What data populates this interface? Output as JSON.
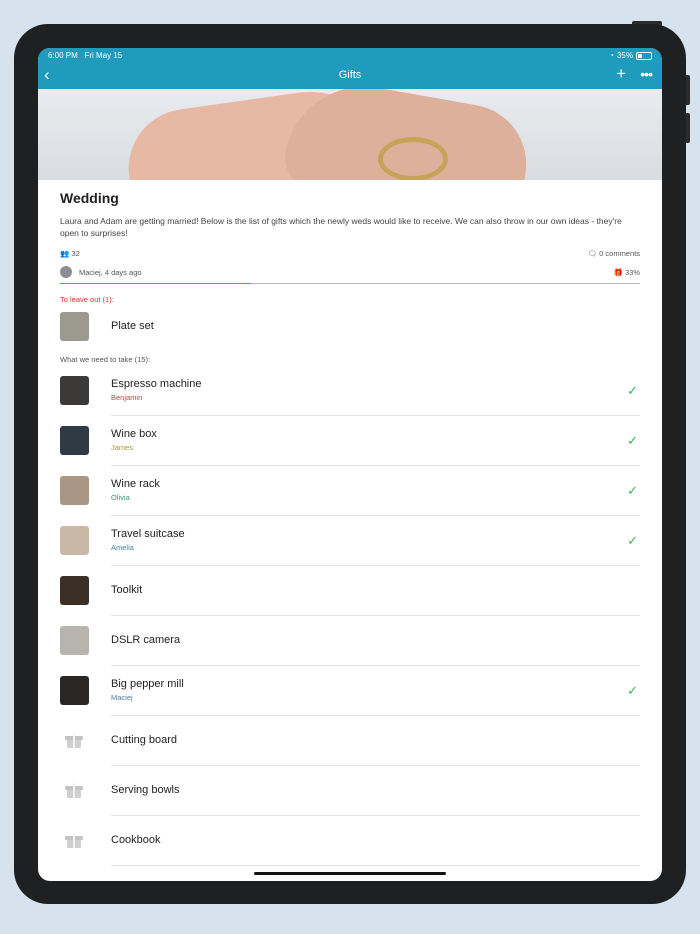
{
  "status_bar": {
    "time": "6:00 PM",
    "date": "Fri May 15",
    "battery": "35%"
  },
  "nav": {
    "back_icon": "chevron-left-icon",
    "title": "Gifts",
    "add_icon": "plus-icon",
    "more_icon": "more-icon"
  },
  "event": {
    "title": "Wedding",
    "description": "Laura and Adam are getting married! Below is the list of gifts which the newly weds would like to receive. We can also throw in our own ideas - they're open to surprises!",
    "participants": "32",
    "comments": "0 comments",
    "author": "Maciej, 4 days ago",
    "progress_label": "33%",
    "progress": 0.33
  },
  "sections": {
    "leave_out": "To leave out (1):",
    "to_take": "What we need to take (15):"
  },
  "leave_out_items": [
    {
      "name": "Plate set"
    }
  ],
  "items": [
    {
      "name": "Espresso machine",
      "taken_by": "Benjamin",
      "taken_by_color": "#b5453b",
      "checked": true,
      "thumb": "#3b3a38"
    },
    {
      "name": "Wine box",
      "taken_by": "James",
      "taken_by_color": "#a0a02a",
      "checked": true,
      "thumb": "#2f3a44"
    },
    {
      "name": "Wine rack",
      "taken_by": "Olivia",
      "taken_by_color": "#2f9a6a",
      "checked": true,
      "thumb": "#a99684"
    },
    {
      "name": "Travel suitcase",
      "taken_by": "Amelia",
      "taken_by_color": "#4a7fa8",
      "checked": true,
      "thumb": "#c9b8a5"
    },
    {
      "name": "Toolkit",
      "taken_by": "",
      "checked": false,
      "thumb": "#3c2f25"
    },
    {
      "name": "DSLR camera",
      "taken_by": "",
      "checked": false,
      "thumb": "#b7b4ad"
    },
    {
      "name": "Big pepper mill",
      "taken_by": "Maciej",
      "taken_by_color": "#4a7fa8",
      "checked": true,
      "thumb": "#2a2624"
    },
    {
      "name": "Cutting board",
      "taken_by": "",
      "checked": false,
      "thumb": ""
    },
    {
      "name": "Serving bowls",
      "taken_by": "",
      "checked": false,
      "thumb": ""
    },
    {
      "name": "Cookbook",
      "taken_by": "",
      "checked": false,
      "thumb": ""
    }
  ],
  "colors": {
    "header": "#1e9bbd",
    "accent_green": "#3fb64f",
    "leave_out_red": "#d9332a"
  }
}
